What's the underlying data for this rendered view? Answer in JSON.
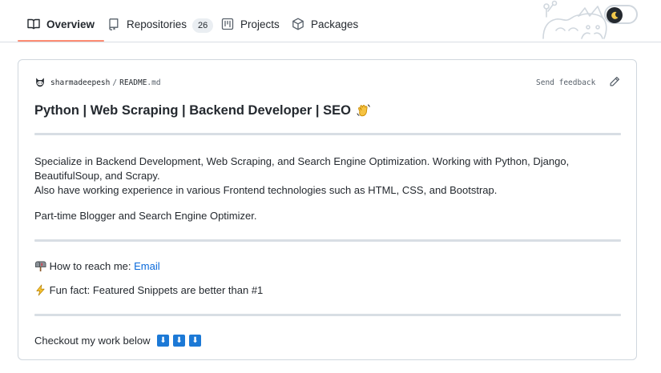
{
  "tabs": [
    {
      "label": "Overview",
      "icon": "book-icon",
      "selected": true
    },
    {
      "label": "Repositories",
      "icon": "repo-icon",
      "count": "26"
    },
    {
      "label": "Projects",
      "icon": "project-icon"
    },
    {
      "label": "Packages",
      "icon": "package-icon"
    }
  ],
  "readme": {
    "owner": "sharmadeepesh",
    "separator": "/",
    "file_name": "README",
    "file_ext": ".md",
    "feedback_label": "Send feedback",
    "heading": "Python | Web Scraping | Backend Developer | SEO",
    "intro_line1": "Specialize in Backend Development, Web Scraping, and Search Engine Optimization. Working with Python, Django, BeautifulSoup, and Scrapy.",
    "intro_line2": "Also have working experience in various Frontend technologies such as HTML, CSS, and Bootstrap.",
    "blogger_line": "Part-time Blogger and Search Engine Optimizer.",
    "reach_label": "How to reach me: ",
    "reach_link": "Email",
    "fun_fact": "Fun fact: Featured Snippets are better than #1",
    "checkout": "Checkout my work below"
  },
  "colors": {
    "accent_underline": "#fd8c73",
    "link": "#0969da",
    "arrow_emoji": "#1c79d6"
  }
}
